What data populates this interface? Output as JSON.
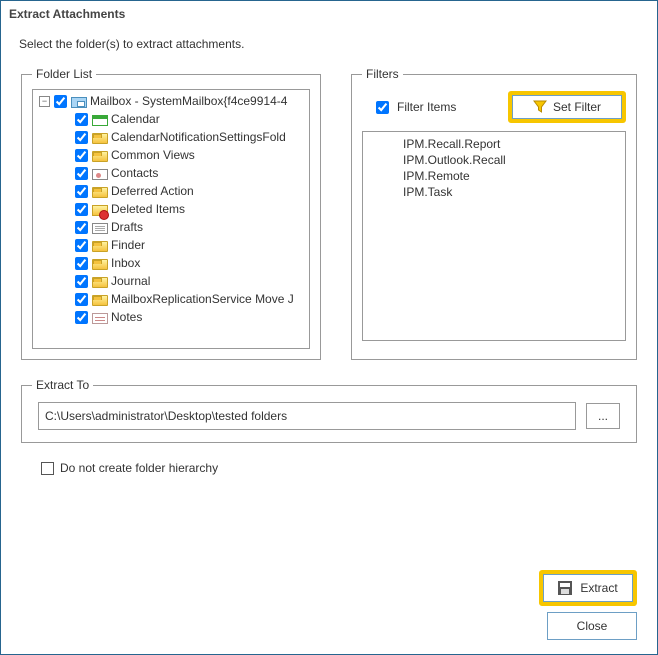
{
  "window": {
    "title": "Extract Attachments"
  },
  "instruction": "Select the folder(s) to extract attachments.",
  "folder_list": {
    "legend": "Folder List",
    "root": {
      "label": "Mailbox - SystemMailbox{f4ce9914-4",
      "checked": true,
      "icon": "mailbox"
    },
    "items": [
      {
        "label": "Calendar",
        "checked": true,
        "icon": "calendar"
      },
      {
        "label": "CalendarNotificationSettingsFold",
        "checked": true,
        "icon": "folder"
      },
      {
        "label": "Common Views",
        "checked": true,
        "icon": "folder"
      },
      {
        "label": "Contacts",
        "checked": true,
        "icon": "contacts"
      },
      {
        "label": "Deferred Action",
        "checked": true,
        "icon": "folder"
      },
      {
        "label": "Deleted Items",
        "checked": true,
        "icon": "deleted"
      },
      {
        "label": "Drafts",
        "checked": true,
        "icon": "drafts"
      },
      {
        "label": "Finder",
        "checked": true,
        "icon": "folder"
      },
      {
        "label": "Inbox",
        "checked": true,
        "icon": "folder"
      },
      {
        "label": "Journal",
        "checked": true,
        "icon": "folder"
      },
      {
        "label": "MailboxReplicationService Move J",
        "checked": true,
        "icon": "folder"
      },
      {
        "label": "Notes",
        "checked": true,
        "icon": "notes"
      }
    ]
  },
  "filters": {
    "legend": "Filters",
    "filter_items_label": "Filter Items",
    "filter_items_checked": true,
    "set_filter_label": "Set Filter",
    "items": [
      "IPM.Recall.Report",
      "IPM.Outlook.Recall",
      "IPM.Remote",
      "IPM.Task"
    ]
  },
  "extract_to": {
    "legend": "Extract To",
    "path": "C:\\Users\\administrator\\Desktop\\tested folders",
    "browse_label": "..."
  },
  "options": {
    "no_hierarchy_label": "Do not create folder hierarchy",
    "no_hierarchy_checked": false
  },
  "buttons": {
    "extract": "Extract",
    "close": "Close"
  }
}
